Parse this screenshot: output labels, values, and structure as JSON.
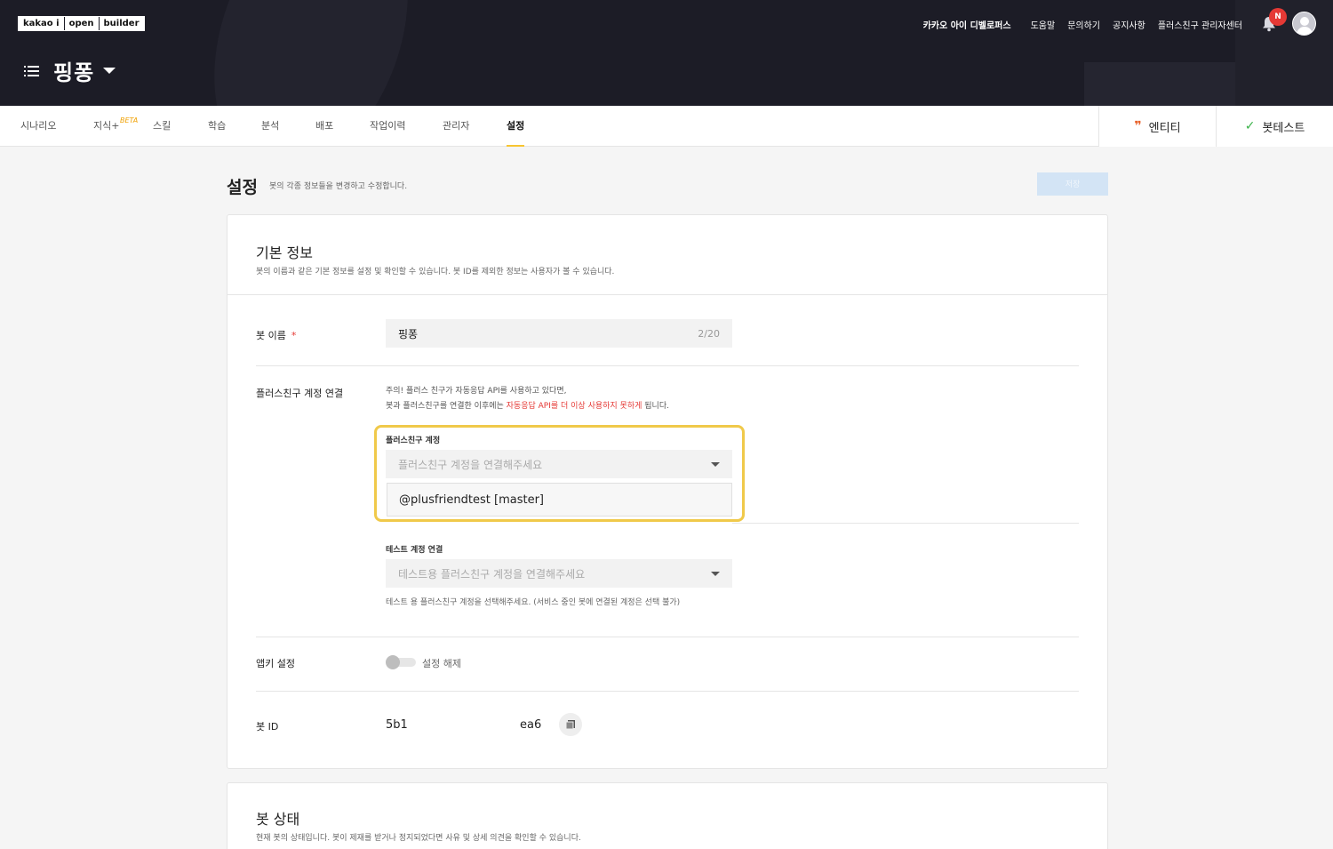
{
  "header": {
    "logo_parts": [
      "kakao i",
      "open",
      "builder"
    ],
    "bot_name": "핑퐁",
    "nav": [
      "카카오 아이 디벨로퍼스",
      "도움말",
      "문의하기",
      "공지사항",
      "플러스친구 관리자센터"
    ],
    "notification_badge": "N"
  },
  "tabs": [
    {
      "label": "시나리오"
    },
    {
      "label": "지식+"
    },
    {
      "label": "스킬"
    },
    {
      "label": "학습"
    },
    {
      "label": "분석"
    },
    {
      "label": "배포"
    },
    {
      "label": "작업이력"
    },
    {
      "label": "관리자"
    },
    {
      "label": "설정"
    }
  ],
  "beta_label": "BETA",
  "right_buttons": {
    "entity": "엔티티",
    "bot_test": "봇테스트"
  },
  "page": {
    "title": "설정",
    "description": "봇의 각종 정보들을 변경하고 수정합니다.",
    "save_label": "저장"
  },
  "basic_info": {
    "title": "기본 정보",
    "description": "봇의 이름과 같은 기본 정보를 설정 및 확인할 수 있습니다. 봇 ID를 제외한 정보는 사용자가 볼 수 있습니다.",
    "bot_name_label": "봇 이름",
    "bot_name_required": "*",
    "bot_name_value": "핑퐁",
    "bot_name_count": "2/20",
    "plusfriend_label": "플러스친구 계정 연결",
    "notice_line1": "주의! 플러스 친구가 자동응답 API를 사용하고 있다면,",
    "notice_line2_prefix": "봇과 플러스친구를 연결한 이후에는 ",
    "notice_line2_warn": "자동응답 API를 더 이상 사용하지 못하게",
    "notice_line2_suffix": " 됩니다.",
    "plusfriend_account_label": "플러스친구 계정",
    "plusfriend_account_placeholder": "플러스친구 계정을 연결해주세요",
    "plusfriend_option": "@plusfriendtest [master]",
    "test_account_label": "테스트 계정 연결",
    "test_account_placeholder": "테스트용 플러스친구 계정을 연결해주세요",
    "test_account_note": "테스트 용 플러스친구 계정을 선택해주세요. (서비스 중인 봇에 연결된 계정은 선택 불가)",
    "appkey_label": "앱키 설정",
    "appkey_toggle_label": "설정 해제",
    "appkey_enabled": false,
    "bot_id_label": "봇 ID",
    "bot_id_part1": "5b1",
    "bot_id_part2": "ea6"
  },
  "bot_status": {
    "title": "봇 상태",
    "description": "현재 봇의 상태입니다. 봇이 제재를 받거나 정지되었다면 사유 및 상세 의견을 확인할 수 있습니다."
  },
  "colors": {
    "header_bg": "#1c1c26",
    "accent": "#f7c531",
    "warn": "#e53935",
    "highlight": "#f0c94a"
  }
}
